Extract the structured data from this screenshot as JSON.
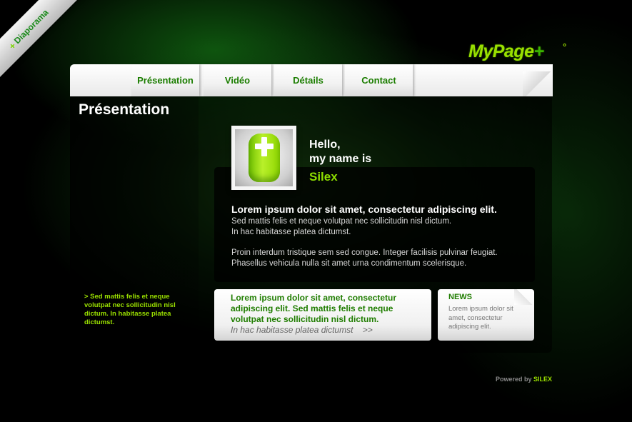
{
  "corner_ribbon": {
    "plus": "+",
    "label": "Diaporama"
  },
  "logo": {
    "text": "MyPage",
    "plus": "+",
    "dot": "°"
  },
  "nav": {
    "tabs": [
      {
        "label": "Présentation"
      },
      {
        "label": "Vidéo"
      },
      {
        "label": "Détails"
      },
      {
        "label": "Contact"
      }
    ]
  },
  "page": {
    "title": "Présentation"
  },
  "intro": {
    "hello_line1": "Hello,",
    "hello_line2": "my name is",
    "name": "Silex"
  },
  "content": {
    "heading": "Lorem ipsum dolor sit amet, consectetur adipiscing elit.",
    "para1_line1": "Sed mattis felis et neque volutpat nec sollicitudin nisl dictum.",
    "para1_line2": "In hac habitasse platea dictumst.",
    "para2_line1": "Proin interdum tristique sem sed congue. Integer facilisis pulvinar feugiat.",
    "para2_line2": "Phasellus vehicula nulla sit amet urna condimentum scelerisque."
  },
  "side_note": "> Sed mattis felis et neque volutpat nec sollicitudin nisl dictum. In habitasse platea dictumst.",
  "card": {
    "text": "Lorem ipsum dolor sit amet, consectetur adipiscing elit. Sed mattis felis et neque volutpat nec sollicitudin nisl dictum.",
    "link": "In hac habitasse platea dictumst    >>"
  },
  "news": {
    "title": "NEWS",
    "text": "Lorem ipsum dolor sit amet, consectetur adipiscing elit."
  },
  "footer": {
    "powered_prefix": "Powered by ",
    "brand": "SILEX"
  },
  "colors": {
    "accent": "#9ae000",
    "nav_text": "#1b7d00",
    "background": "#000000"
  }
}
